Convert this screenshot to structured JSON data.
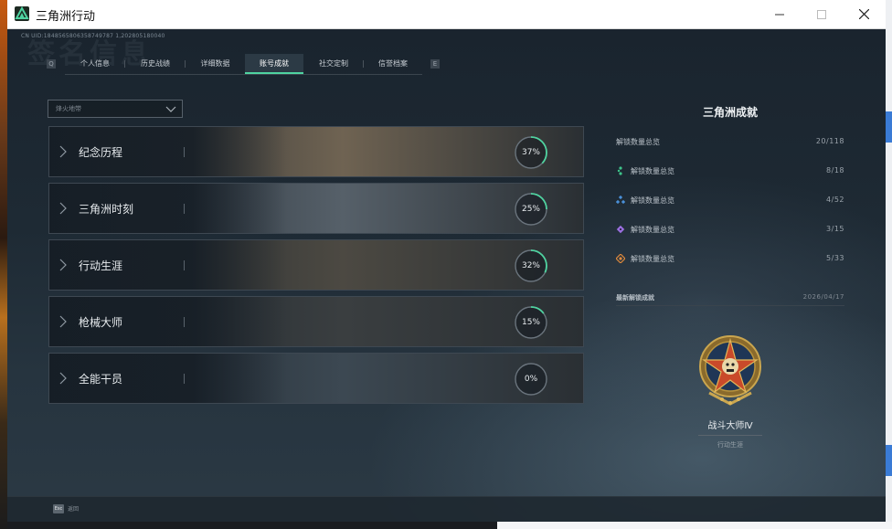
{
  "window": {
    "title": "三角洲行动"
  },
  "header": {
    "uid": "CN UID:1848565806358749787 1,202805180040",
    "ghost_title": "签名信息"
  },
  "tabs": [
    {
      "label": "个人信息",
      "active": false
    },
    {
      "label": "历史战绩",
      "active": false
    },
    {
      "label": "详细数据",
      "active": false
    },
    {
      "label": "账号成就",
      "active": true
    },
    {
      "label": "社交定制",
      "active": false
    },
    {
      "label": "信誉档案",
      "active": false
    }
  ],
  "tab_arrows": {
    "left": "Q",
    "right": "E"
  },
  "filter": {
    "value": "烽火地带"
  },
  "categories": [
    {
      "name": "纪念历程",
      "percent_label": "37%",
      "percent": 0.37,
      "bg": "#6f6352"
    },
    {
      "name": "三角洲时刻",
      "percent_label": "25%",
      "percent": 0.25,
      "bg": "#566069"
    },
    {
      "name": "行动生涯",
      "percent_label": "32%",
      "percent": 0.32,
      "bg": "#4c4942"
    },
    {
      "name": "枪械大师",
      "percent_label": "15%",
      "percent": 0.15,
      "bg": "#3a3e40"
    },
    {
      "name": "全能干员",
      "percent_label": "0%",
      "percent": 0.0,
      "bg": "#3c4852"
    }
  ],
  "panel": {
    "title": "三角洲成就",
    "summary": {
      "label": "解锁数量总览",
      "count": "20/118"
    },
    "rows": [
      {
        "icon": "green-tier-icon",
        "label": "解锁数量总览",
        "count": "8/18",
        "color": "#3ec48a"
      },
      {
        "icon": "blue-tier-icon",
        "label": "解锁数量总览",
        "count": "4/52",
        "color": "#4a90d9"
      },
      {
        "icon": "purple-tier-icon",
        "label": "解锁数量总览",
        "count": "3/15",
        "color": "#9b6fe0"
      },
      {
        "icon": "orange-tier-icon",
        "label": "解锁数量总览",
        "count": "5/33",
        "color": "#e08a3c"
      }
    ],
    "latest": {
      "label": "最新解锁成就",
      "date": "2026/04/17"
    },
    "badge": {
      "name": "战斗大师Ⅳ",
      "subtitle": "行动生涯"
    }
  },
  "bottom": {
    "key": "Esc",
    "label": "返回"
  },
  "accent": "#4fd3a0"
}
